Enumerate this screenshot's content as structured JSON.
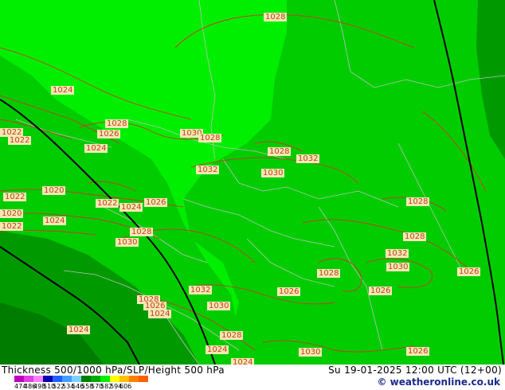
{
  "map": {
    "background_colors": {
      "light_green": "#00ee00",
      "mid_green": "#00cc00",
      "dark_green": "#009a00",
      "darkest_green": "#007c00",
      "contour_red": "#cc3a2a",
      "border_gray": "#b8c4b8",
      "front_black": "#000000"
    },
    "isobar_labels": [
      {
        "text": "1028"
      },
      {
        "text": "1024"
      },
      {
        "text": "1028"
      },
      {
        "text": "1026"
      },
      {
        "text": "1022"
      },
      {
        "text": "1022"
      },
      {
        "text": "1024"
      },
      {
        "text": "1030"
      },
      {
        "text": "1028"
      },
      {
        "text": "1028"
      },
      {
        "text": "1032"
      },
      {
        "text": "1032"
      },
      {
        "text": "1030"
      },
      {
        "text": "1022"
      },
      {
        "text": "1020"
      },
      {
        "text": "1022"
      },
      {
        "text": "1024"
      },
      {
        "text": "1026"
      },
      {
        "text": "1020"
      },
      {
        "text": "1024"
      },
      {
        "text": "1022"
      },
      {
        "text": "1028"
      },
      {
        "text": "1030"
      },
      {
        "text": "1028"
      },
      {
        "text": "1028"
      },
      {
        "text": "1032"
      },
      {
        "text": "1030"
      },
      {
        "text": "1028"
      },
      {
        "text": "1026"
      },
      {
        "text": "1032"
      },
      {
        "text": "1026"
      },
      {
        "text": "1028"
      },
      {
        "text": "1026"
      },
      {
        "text": "1024"
      },
      {
        "text": "1030"
      },
      {
        "text": "1024"
      },
      {
        "text": "1028"
      },
      {
        "text": "1024"
      },
      {
        "text": "1030"
      },
      {
        "text": "1026"
      },
      {
        "text": "1024"
      },
      {
        "text": "1026"
      }
    ]
  },
  "footer": {
    "title": "Thickness 500/1000 hPa/SLP/Height 500 hPa",
    "valid_time": "Su 19-01-2025 12:00 UTC (12+00)",
    "credit": "© weatheronline.co.uk",
    "legend": {
      "ticks": [
        "474",
        "486",
        "498",
        "510",
        "522",
        "534",
        "546",
        "558",
        "570",
        "582",
        "594",
        "606"
      ],
      "colors": [
        "#c000c0",
        "#e040e0",
        "#ff80ff",
        "#0000b0",
        "#2060ff",
        "#40a0ff",
        "#80d0ff",
        "#008000",
        "#00aa00",
        "#00ee00",
        "#ffff00",
        "#ffc000",
        "#ff8000",
        "#ff6000"
      ]
    }
  }
}
